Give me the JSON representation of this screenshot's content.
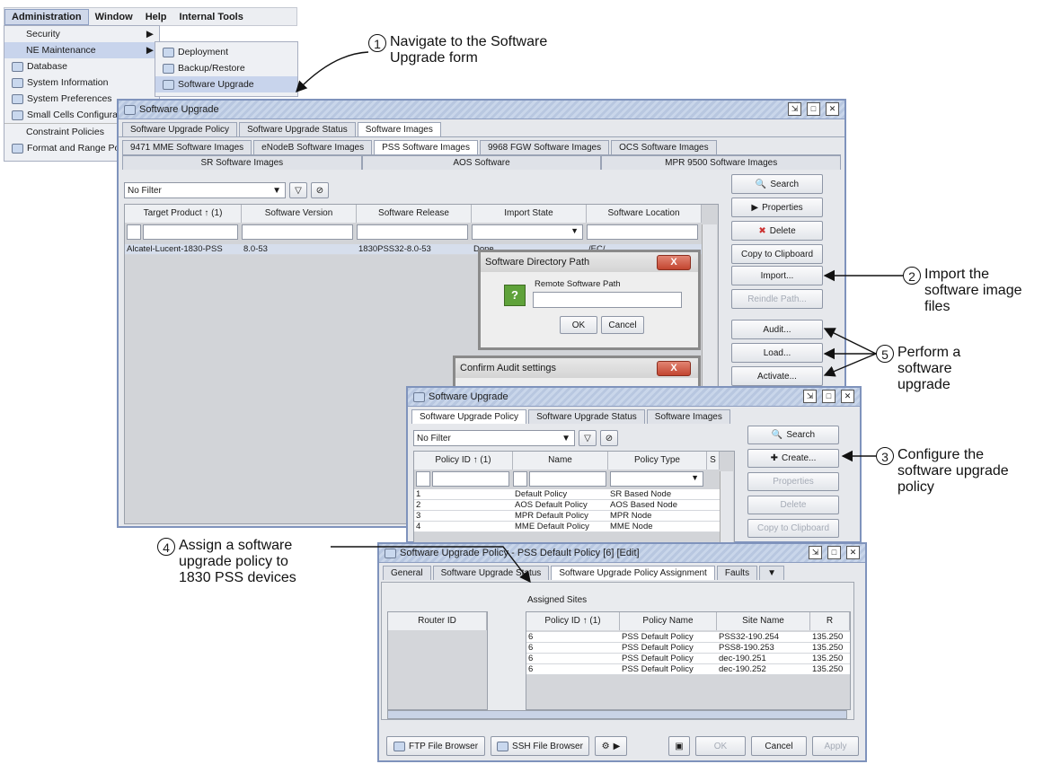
{
  "menubar": {
    "items": [
      "Administration",
      "Window",
      "Help",
      "Internal Tools"
    ]
  },
  "admin_menu": {
    "items": [
      "Security",
      "NE Maintenance",
      "Database",
      "System Information",
      "System Preferences",
      "Small Cells Configurati",
      "Constraint Policies",
      "Format and Range Poli"
    ]
  },
  "submenu": {
    "items": [
      "Deployment",
      "Backup/Restore",
      "Software Upgrade"
    ]
  },
  "win1": {
    "title": "Software Upgrade",
    "tabs": [
      "Software Upgrade Policy",
      "Software Upgrade Status",
      "Software Images"
    ],
    "subtabs_row1": [
      "9471 MME Software Images",
      "eNodeB Software Images",
      "PSS Software Images",
      "9968 FGW Software Images",
      "OCS Software Images"
    ],
    "subtabs_row2": [
      "SR Software Images",
      "AOS Software",
      "MPR 9500 Software Images"
    ],
    "filter": "No Filter",
    "columns": [
      "Target Product ↑ (1)",
      "Software Version",
      "Software Release",
      "Import State",
      "Software Location"
    ],
    "rows": [
      [
        "Alcatel-Lucent-1830-PSS",
        "8.0-53",
        "1830PSS32-8.0-53",
        "Done",
        "/EC/"
      ]
    ],
    "buttons": [
      "Search",
      "Properties",
      "Delete",
      "Copy to Clipboard",
      "Import...",
      "Reindle Path...",
      "Audit...",
      "Load...",
      "Activate..."
    ]
  },
  "dir_dialog": {
    "title": "Software Directory Path",
    "label": "Remote Software Path",
    "ok": "OK",
    "cancel": "Cancel"
  },
  "audit_dialog": {
    "title": "Confirm Audit settings"
  },
  "win2": {
    "title": "Software Upgrade",
    "tabs": [
      "Software Upgrade Policy",
      "Software Upgrade Status",
      "Software Images"
    ],
    "filter": "No Filter",
    "columns": [
      "Policy ID ↑ (1)",
      "Name",
      "Policy Type",
      "S"
    ],
    "rows": [
      [
        "1",
        "Default Policy",
        "SR Based Node"
      ],
      [
        "2",
        "AOS Default Policy",
        "AOS Based Node"
      ],
      [
        "3",
        "MPR Default Policy",
        "MPR Node"
      ],
      [
        "4",
        "MME Default Policy",
        "MME Node"
      ]
    ],
    "buttons": [
      "Search",
      "Create...",
      "Properties",
      "Delete",
      "Copy to Clipboard"
    ]
  },
  "win3": {
    "title": "Software Upgrade Policy - PSS Default Policy [6] [Edit]",
    "tabs": [
      "General",
      "Software Upgrade Status",
      "Software Upgrade Policy Assignment",
      "Faults"
    ],
    "assigned_label": "Assigned Sites",
    "left_column": "Router ID",
    "columns": [
      "Policy ID ↑ (1)",
      "Policy Name",
      "Site Name",
      "R"
    ],
    "rows": [
      [
        "6",
        "PSS Default Policy",
        "PSS32-190.254",
        "135.250"
      ],
      [
        "6",
        "PSS Default Policy",
        "PSS8-190.253",
        "135.250"
      ],
      [
        "6",
        "PSS Default Policy",
        "dec-190.251",
        "135.250"
      ],
      [
        "6",
        "PSS Default Policy",
        "dec-190.252",
        "135.250"
      ]
    ],
    "footer": [
      "FTP File Browser",
      "SSH File Browser",
      "OK",
      "Cancel",
      "Apply"
    ]
  },
  "annotations": {
    "a1": {
      "num": "1",
      "line1": "Navigate to the Software",
      "line2": "Upgrade form"
    },
    "a2": {
      "num": "2",
      "line1": "Import the",
      "line2": "software image",
      "line3": "files"
    },
    "a3": {
      "num": "3",
      "line1": "Configure the",
      "line2": "software upgrade",
      "line3": "policy"
    },
    "a4": {
      "num": "4",
      "line1": "Assign a software",
      "line2": "upgrade policy to",
      "line3": "1830 PSS devices"
    },
    "a5": {
      "num": "5",
      "line1": "Perform a",
      "line2": "software",
      "line3": "upgrade"
    }
  }
}
